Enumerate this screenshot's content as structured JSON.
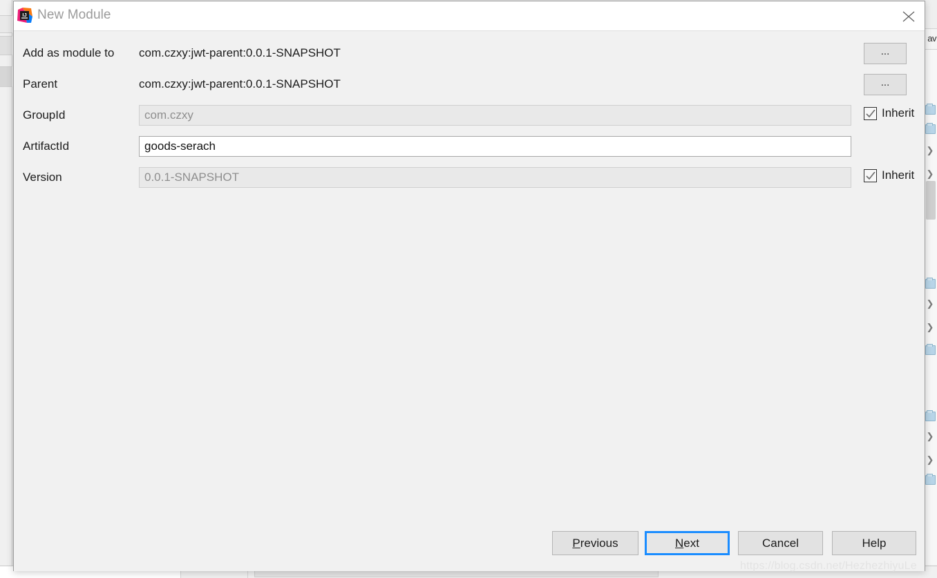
{
  "dialog": {
    "title": "New Module",
    "icon": "intellij-idea-logo",
    "close_icon": "close-icon",
    "fields": [
      {
        "label": "Add as module to",
        "type": "static",
        "value": "com.czxy:jwt-parent:0.0.1-SNAPSHOT",
        "browse_label": "...",
        "has_browse": true,
        "has_inherit": false
      },
      {
        "label": "Parent",
        "type": "static",
        "value": "com.czxy:jwt-parent:0.0.1-SNAPSHOT",
        "browse_label": "...",
        "has_browse": true,
        "has_inherit": false
      },
      {
        "label": "GroupId",
        "type": "input",
        "value": "com.czxy",
        "disabled": true,
        "has_browse": false,
        "has_inherit": true,
        "inherit_label": "Inherit",
        "inherit_checked": true
      },
      {
        "label": "ArtifactId",
        "type": "input",
        "value": "goods-serach",
        "disabled": false,
        "has_browse": false,
        "has_inherit": false
      },
      {
        "label": "Version",
        "type": "input",
        "value": "0.0.1-SNAPSHOT",
        "disabled": true,
        "has_browse": false,
        "has_inherit": true,
        "inherit_label": "Inherit",
        "inherit_checked": true
      }
    ],
    "buttons": [
      {
        "label": "Previous",
        "mnemonic": "P",
        "rest": "revious",
        "focused": false
      },
      {
        "label": "Next",
        "mnemonic": "N",
        "rest": "ext",
        "focused": true
      },
      {
        "label": "Cancel",
        "mnemonic": "",
        "rest": "Cancel",
        "focused": false
      },
      {
        "label": "Help",
        "mnemonic": "",
        "rest": "Help",
        "focused": false
      }
    ]
  },
  "background": {
    "nav_text": "av",
    "watermark": "https://blog.csdn.net/HezhezhiyuLe"
  },
  "colors": {
    "dialog_bg": "#f1f1f1",
    "titlebar_bg": "#ffffff",
    "title_text": "#9b9b9b",
    "field_bg": "#ffffff",
    "field_disabled_bg": "#e9e9e9",
    "field_border": "#a7a7a7",
    "button_bg": "#e2e2e2",
    "focus_accent": "#1a8cff",
    "text": "#1c1c1c",
    "watermark": "#e3e3e3"
  }
}
